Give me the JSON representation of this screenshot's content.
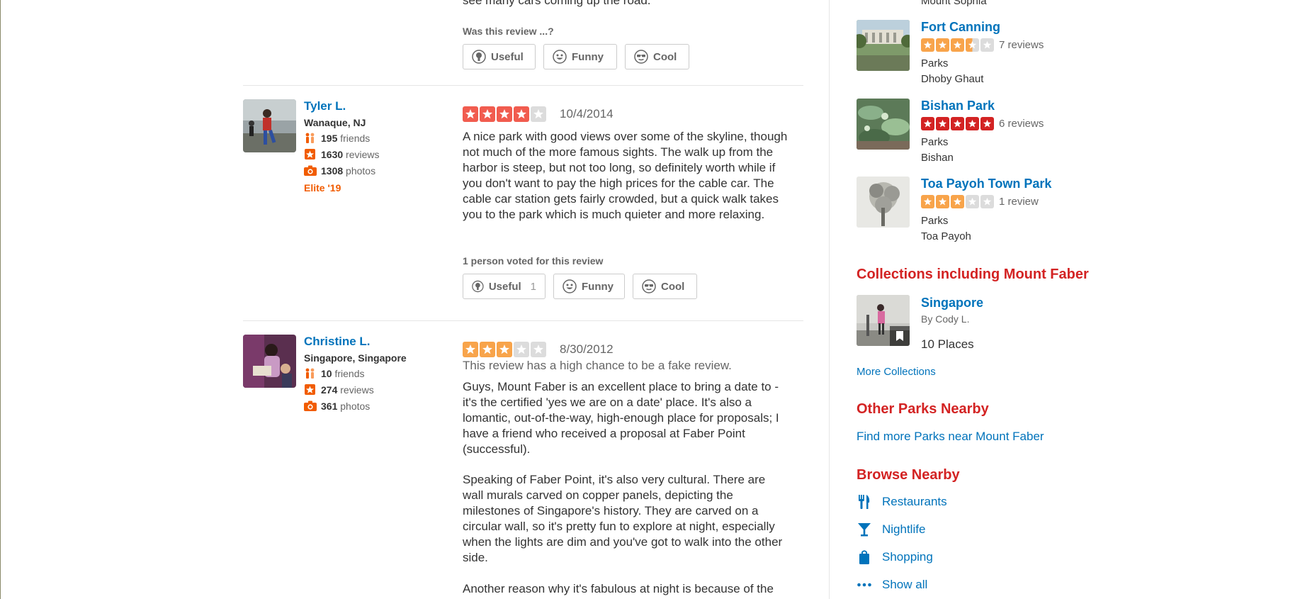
{
  "reviews": {
    "top_partial_text": "see many cars coming up the road.",
    "vote_prompt": "Was this review ...?",
    "buttons": {
      "useful": "Useful",
      "funny": "Funny",
      "cool": "Cool"
    },
    "items": [
      {
        "name": "Tyler L.",
        "location": "Wanaque, NJ",
        "friends": "195",
        "friends_label": "friends",
        "reviews": "1630",
        "reviews_label": "reviews",
        "photos": "1308",
        "photos_label": "photos",
        "elite": "Elite '19",
        "rating": 4,
        "date": "10/4/2014",
        "text": "A nice park with good views over some of the skyline, though not much of the more famous sights. The walk up from the harbor is steep, but not too long, so definitely worth while if you don't want to pay the high prices for the cable car. The cable car station gets fairly crowded, but a quick walk takes you to the park which is much quieter and more relaxing.",
        "vote_label": "1 person voted for this review",
        "useful_count": "1"
      },
      {
        "name": "Christine L.",
        "location": "Singapore, Singapore",
        "friends": "10",
        "friends_label": "friends",
        "reviews": "274",
        "reviews_label": "reviews",
        "photos": "361",
        "photos_label": "photos",
        "rating": 3,
        "date": "8/30/2012",
        "fake_notice": "This review has a high chance to be a fake review.",
        "paragraphs": [
          "Guys, Mount Faber is an excellent place to bring a date to - it's the certified 'yes we are on a date' place. It's also a lomantic, out-of-the-way, high-enough place for proposals; I have a friend who received a proposal at Faber Point (successful).",
          "Speaking of Faber Point, it's also very cultural. There are wall murals carved on copper panels, depicting the milestones of Singapore's history. They are carved on a circular wall, so it's pretty fun to explore at night, especially when the lights are dim and you've got to walk into the other side.",
          "Another reason why it's fabulous at night is because of the"
        ]
      }
    ]
  },
  "sidebar": {
    "top_partial": "Mount Sophia",
    "businesses": [
      {
        "name": "Fort Canning",
        "rating": 3.5,
        "reviews": "7 reviews",
        "category": "Parks",
        "neighborhood": "Dhoby Ghaut"
      },
      {
        "name": "Bishan Park",
        "rating": 5,
        "reviews": "6 reviews",
        "category": "Parks",
        "neighborhood": "Bishan"
      },
      {
        "name": "Toa Payoh Town Park",
        "rating": 3,
        "reviews": "1 review",
        "category": "Parks",
        "neighborhood": "Toa Payoh"
      }
    ],
    "collections": {
      "title": "Collections including Mount Faber",
      "item_name": "Singapore",
      "item_by": "By Cody L.",
      "item_places": "10 Places",
      "more": "More Collections"
    },
    "other_parks": {
      "title": "Other Parks Nearby",
      "link": "Find more Parks near Mount Faber"
    },
    "browse": {
      "title": "Browse Nearby",
      "items": [
        {
          "label": "Restaurants",
          "icon": "fork-knife-icon"
        },
        {
          "label": "Nightlife",
          "icon": "cocktail-icon"
        },
        {
          "label": "Shopping",
          "icon": "shopping-bag-icon"
        },
        {
          "label": "Show all",
          "icon": "ellipsis-icon"
        }
      ]
    }
  },
  "colors": {
    "link": "#0073bb",
    "section_red": "#d32323",
    "elite_orange": "#f15c00",
    "star_4": "#f15c4f",
    "star_3": "#f8a44b",
    "star_5": "#d32323"
  }
}
